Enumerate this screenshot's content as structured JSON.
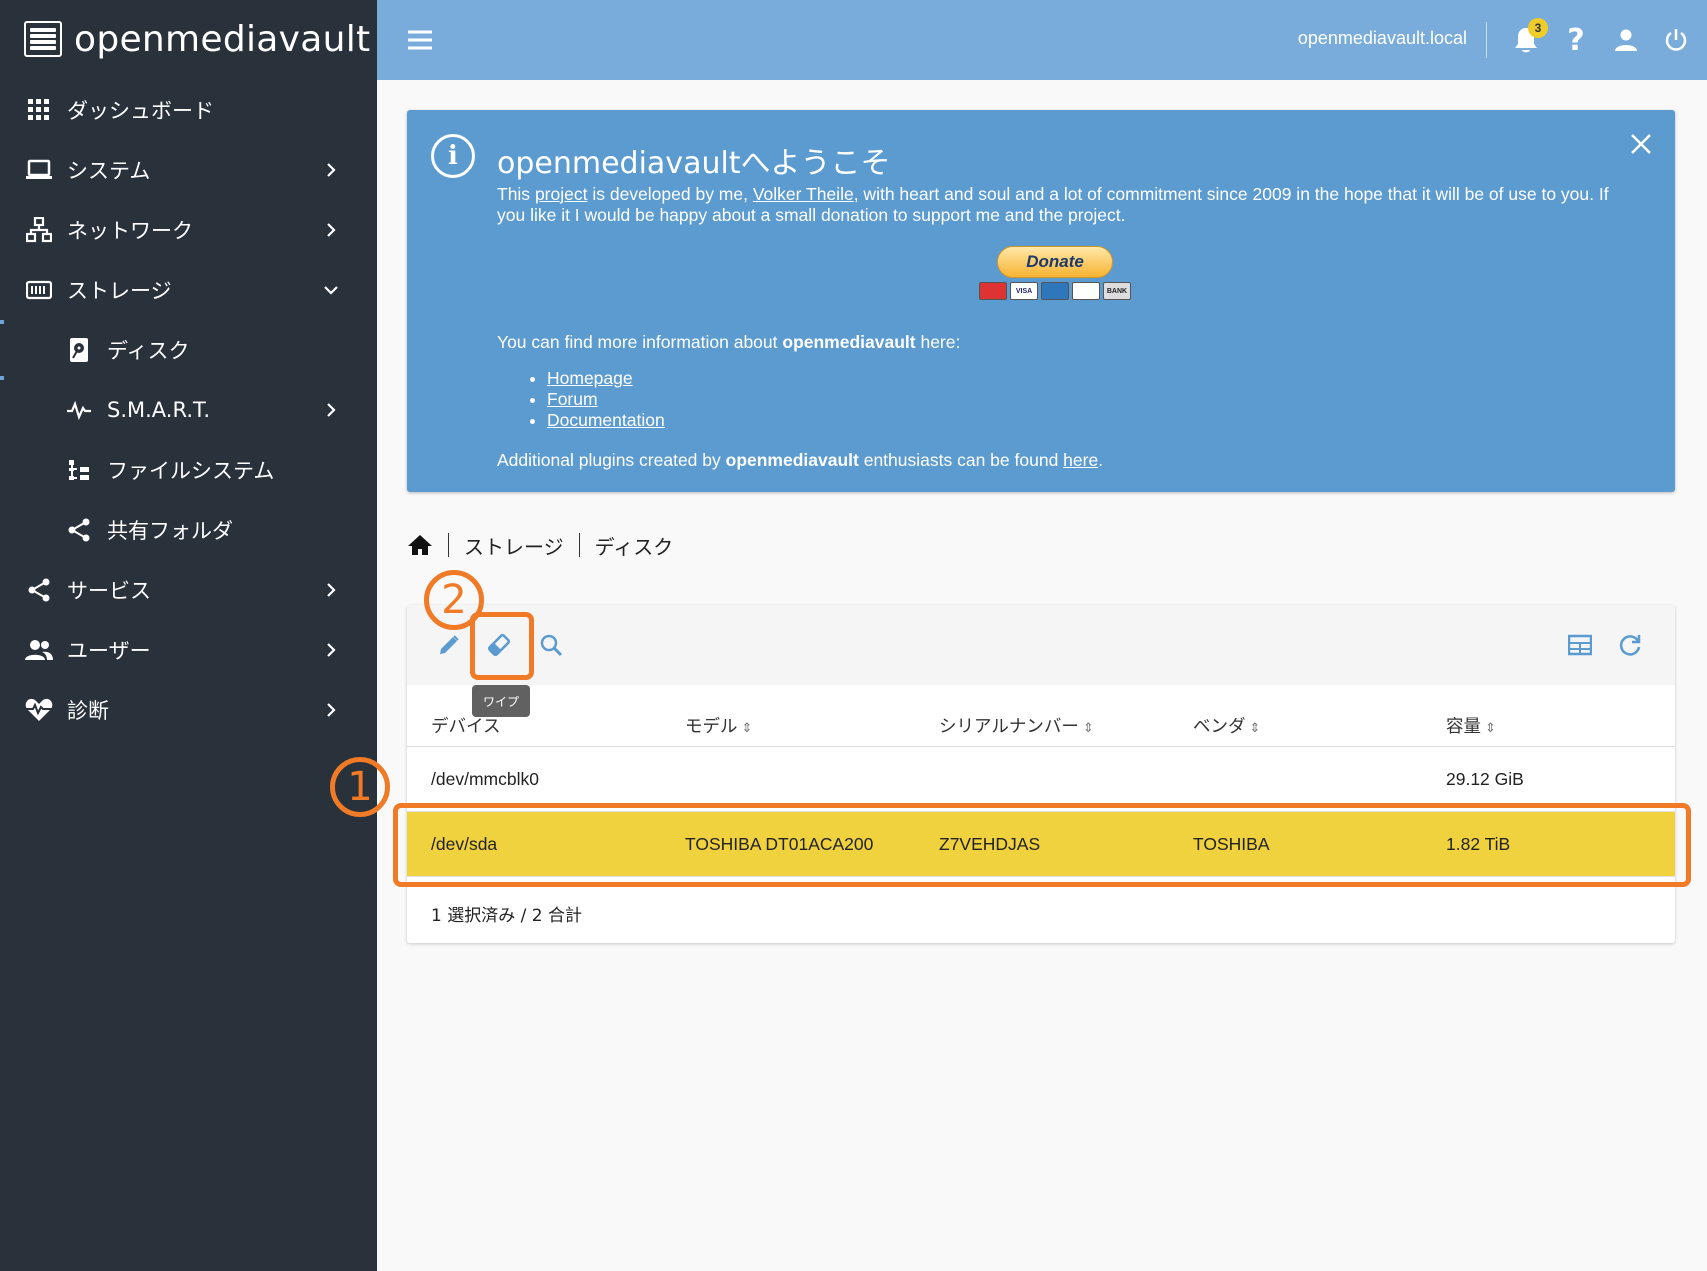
{
  "app": {
    "brand": "openmediavault"
  },
  "sidebar": {
    "items": [
      {
        "label": "ダッシュボード",
        "icon": "dashboard-grid-icon"
      },
      {
        "label": "システム",
        "icon": "laptop-icon"
      },
      {
        "label": "ネットワーク",
        "icon": "network-icon"
      },
      {
        "label": "ストレージ",
        "icon": "storage-icon"
      },
      {
        "label": "ディスク",
        "icon": "disk-icon"
      },
      {
        "label": "S.M.A.R.T.",
        "icon": "pulse-icon"
      },
      {
        "label": "ファイルシステム",
        "icon": "file-tree-icon"
      },
      {
        "label": "共有フォルダ",
        "icon": "share-icon"
      },
      {
        "label": "サービス",
        "icon": "share-icon"
      },
      {
        "label": "ユーザー",
        "icon": "users-icon"
      },
      {
        "label": "診断",
        "icon": "heart-pulse-icon"
      }
    ]
  },
  "topbar": {
    "hostname": "openmediavault.local",
    "notification_count": "3"
  },
  "welcome": {
    "title": "openmediavaultへようこそ",
    "intro_1": "This ",
    "intro_link_1": "project",
    "intro_2": " is developed by me, ",
    "intro_link_2": "Volker Theile",
    "intro_3": ", with heart and soul and a lot of commitment since 2009 in the hope that it will be of use to you. If you like it I would be happy about a small donation to support me and the project.",
    "donate_label": "Donate",
    "cards": [
      "MasterCard",
      "VISA",
      "AMEX",
      "DISCOVER",
      "BANK"
    ],
    "more_1": "You can find more information about ",
    "more_bold": "openmediavault",
    "more_2": " here:",
    "links": [
      "Homepage",
      "Forum",
      "Documentation"
    ],
    "plugins_1": "Additional plugins created by ",
    "plugins_bold": "openmediavault",
    "plugins_2": " enthusiasts can be found ",
    "plugins_link": "here",
    "plugins_3": "."
  },
  "breadcrumb": {
    "level1": "ストレージ",
    "level2": "ディスク"
  },
  "table": {
    "tooltip": "ワイプ",
    "columns": [
      "デバイス",
      "モデル",
      "シリアルナンバー",
      "ベンダ",
      "容量"
    ],
    "rows": [
      {
        "device": "/dev/mmcblk0",
        "model": "",
        "serial": "",
        "vendor": "",
        "capacity": "29.12 GiB"
      },
      {
        "device": "/dev/sda",
        "model": "TOSHIBA DT01ACA200",
        "serial": "Z7VEHDJAS",
        "vendor": "TOSHIBA",
        "capacity": "1.82 TiB"
      }
    ],
    "footer": "1 選択済み / 2 合計"
  },
  "annotations": {
    "step1": "1",
    "step2": "2",
    "accent": "#f07a26"
  },
  "colors": {
    "sidebar_bg": "#29313b",
    "topbar_bg": "#79acdb",
    "welcome_bg": "#5b9bd0",
    "selected_row": "#f0d23e"
  }
}
